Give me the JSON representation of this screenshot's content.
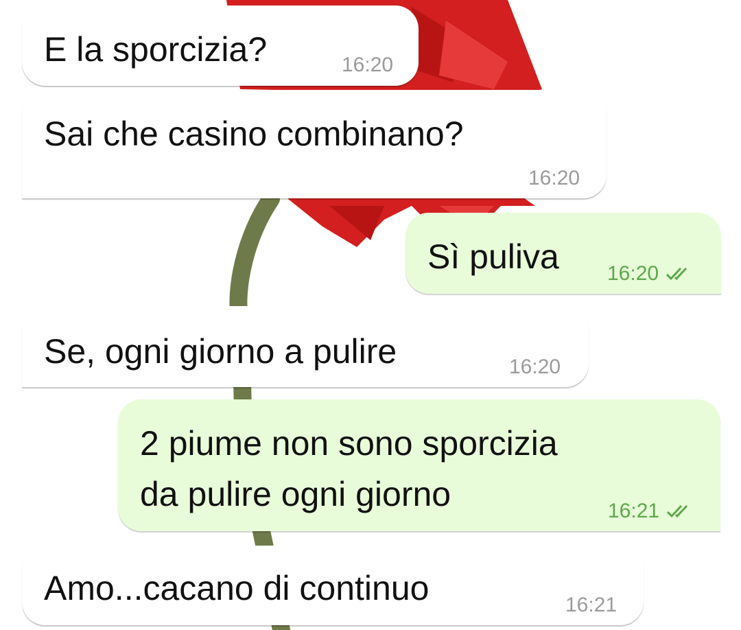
{
  "chat": {
    "messages": [
      {
        "direction": "incoming",
        "text": "E la sporcizia?",
        "time": "16:20"
      },
      {
        "direction": "incoming",
        "text": "Sai che casino combinano?",
        "time": "16:20"
      },
      {
        "direction": "outgoing",
        "text": "Sì puliva",
        "time": "16:20",
        "status": "read",
        "status_icon": "double-check-icon"
      },
      {
        "direction": "incoming",
        "text": "Se, ogni giorno a pulire",
        "time": "16:20"
      },
      {
        "direction": "outgoing",
        "text_line1": "2 piume non sono sporcizia",
        "text_line2": "da pulire ogni giorno",
        "time": "16:21",
        "status": "read",
        "status_icon": "double-check-icon"
      },
      {
        "direction": "incoming",
        "text": "Amo...cacano di continuo",
        "time": "16:21"
      }
    ]
  },
  "colors": {
    "incoming_bubble": "#ffffff",
    "outgoing_bubble": "#e8fcd9",
    "timestamp_incoming": "#9a9a9a",
    "timestamp_outgoing": "#5ca84a",
    "wallpaper_flower": "#d31f1f",
    "wallpaper_stem": "#6f7a4a"
  },
  "wallpaper": {
    "subject": "red gerbera flower",
    "icon": "flower-wallpaper"
  }
}
